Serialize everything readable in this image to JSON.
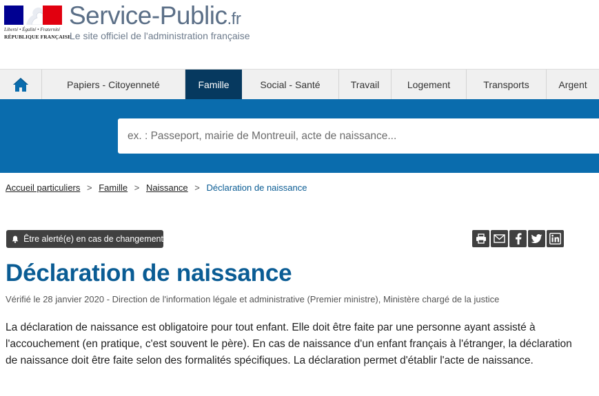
{
  "header": {
    "logo": {
      "devise": "Liberté • Égalité • Fraternité",
      "republique": "RÉPUBLIQUE FRANÇAISE"
    },
    "brand_main": "Service-Public",
    "brand_suffix": ".fr",
    "tagline": "Le site officiel de l'administration française"
  },
  "nav": {
    "home_icon": "home-icon",
    "items": [
      {
        "label": "Papiers - Citoyenneté"
      },
      {
        "label": "Famille",
        "active": true
      },
      {
        "label": "Social - Santé"
      },
      {
        "label": "Travail"
      },
      {
        "label": "Logement"
      },
      {
        "label": "Transports"
      },
      {
        "label": "Argent"
      }
    ]
  },
  "search": {
    "placeholder": "ex. : Passeport, mairie de Montreuil, acte de naissance..."
  },
  "breadcrumb": {
    "items": [
      "Accueil particuliers",
      "Famille",
      "Naissance"
    ],
    "separator": ">",
    "current": "Déclaration de naissance"
  },
  "alert": {
    "icon": "bell-icon",
    "label": "Être alerté(e) en cas de changement"
  },
  "share": {
    "icons": [
      "print-icon",
      "email-icon",
      "facebook-icon",
      "twitter-icon",
      "linkedin-icon"
    ]
  },
  "page": {
    "title": "Déclaration de naissance",
    "meta": "Vérifié le 28 janvier 2020 - Direction de l'information légale et administrative (Premier ministre), Ministère chargé de la justice",
    "intro": "La déclaration de naissance est obligatoire pour tout enfant. Elle doit être faite par une personne ayant assisté à l'accouchement (en pratique, c'est souvent le père). En cas de naissance d'un enfant français à l'étranger, la déclaration de naissance doit être faite selon des formalités spécifiques. La déclaration permet d'établir l'acte de naissance."
  },
  "colors": {
    "nav_active": "#06395f",
    "search_band": "#0a6cad",
    "title": "#0a5c94",
    "flag_blue": "#000091",
    "flag_red": "#e1000f"
  }
}
